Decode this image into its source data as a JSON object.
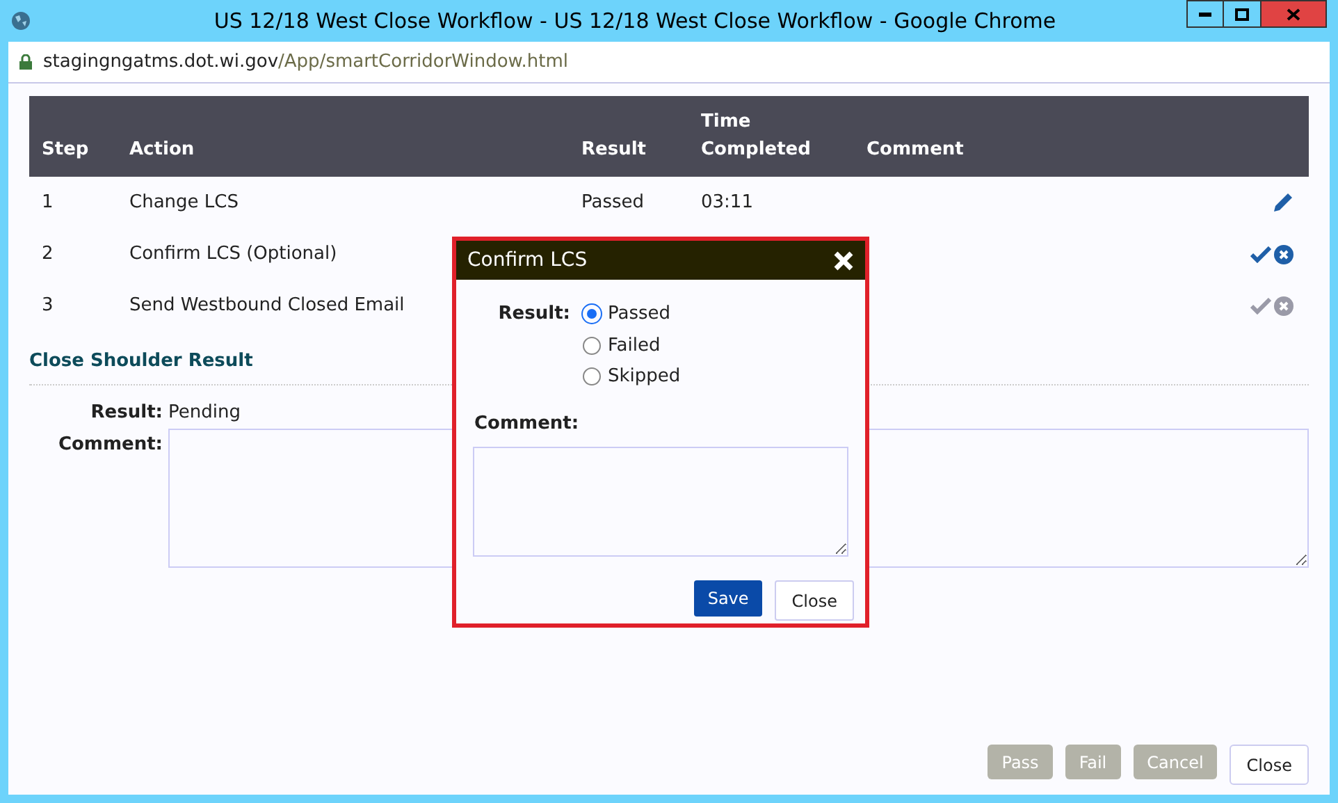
{
  "window": {
    "title": "US 12/18 West Close Workflow - US 12/18 West Close Workflow - Google Chrome",
    "address_host": "stagingngatms.dot.wi.gov",
    "address_path": "/App/smartCorridorWindow.html"
  },
  "table": {
    "columns": [
      "Step",
      "Action",
      "Result",
      "Time Completed",
      "Comment"
    ],
    "rows": [
      {
        "step": "1",
        "action": "Change LCS",
        "result": "Passed",
        "time": "03:11",
        "kind": "edit"
      },
      {
        "step": "2",
        "action": "Confirm LCS (Optional)",
        "kind": "active"
      },
      {
        "step": "3",
        "action": "Send Westbound Closed Email",
        "kind": "inactive"
      }
    ]
  },
  "section": {
    "title": "Close Shoulder Result",
    "result_label": "Result:",
    "result_value": "Pending",
    "comment_label": "Comment:"
  },
  "dialog": {
    "title": "Confirm LCS",
    "result_label": "Result:",
    "options": [
      {
        "label": "Passed",
        "selected": true
      },
      {
        "label": "Failed",
        "selected": false
      },
      {
        "label": "Skipped",
        "selected": false
      }
    ],
    "comment_label": "Comment:",
    "buttons": [
      {
        "label": "Save",
        "kind": "primary"
      },
      {
        "label": "Close",
        "kind": "secondary"
      }
    ]
  },
  "footer_buttons": [
    {
      "label": "Pass",
      "disabled": true
    },
    {
      "label": "Fail",
      "disabled": true
    },
    {
      "label": "Cancel",
      "disabled": true
    },
    {
      "label": "Close",
      "disabled": false
    }
  ]
}
